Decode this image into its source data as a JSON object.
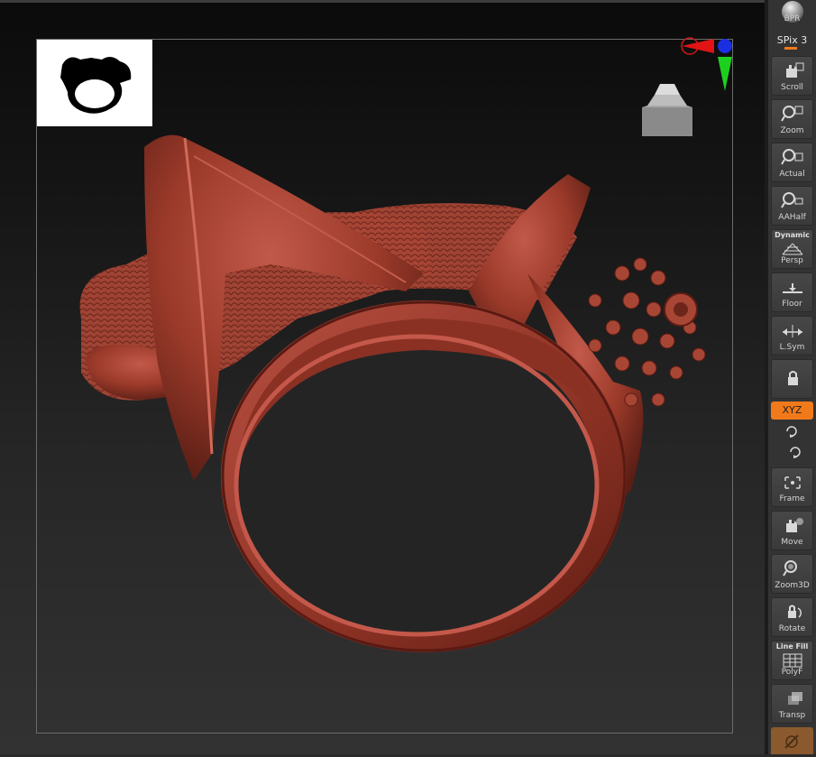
{
  "shelf": {
    "bpr_label": "BPR",
    "spix_label": "SPix 3",
    "buttons": [
      {
        "label": "Scroll",
        "icon": "scroll-icon"
      },
      {
        "label": "Zoom",
        "icon": "zoom-icon"
      },
      {
        "label": "Actual",
        "icon": "actual-icon"
      },
      {
        "label": "AAHalf",
        "icon": "aahalf-icon"
      },
      {
        "label": "Persp",
        "icon": "persp-icon",
        "top_label": "Dynamic"
      },
      {
        "label": "Floor",
        "icon": "floor-icon"
      },
      {
        "label": "L.Sym",
        "icon": "lsym-icon"
      },
      {
        "label": "",
        "icon": "lock-icon"
      },
      {
        "label": "Frame",
        "icon": "frame-icon"
      },
      {
        "label": "Move",
        "icon": "move-icon"
      },
      {
        "label": "Zoom3D",
        "icon": "zoom3d-icon"
      },
      {
        "label": "Rotate",
        "icon": "rotate-icon"
      },
      {
        "label": "PolyF",
        "icon": "polyf-icon",
        "top_label": "Line Fill"
      },
      {
        "label": "Transp",
        "icon": "transp-icon"
      }
    ],
    "xyz_label": "XYZ",
    "active_color": "#f07a1a"
  },
  "canvas": {
    "model_color": "#a3402f",
    "background_top": "#0b0b0b",
    "background_bottom": "#323232"
  }
}
